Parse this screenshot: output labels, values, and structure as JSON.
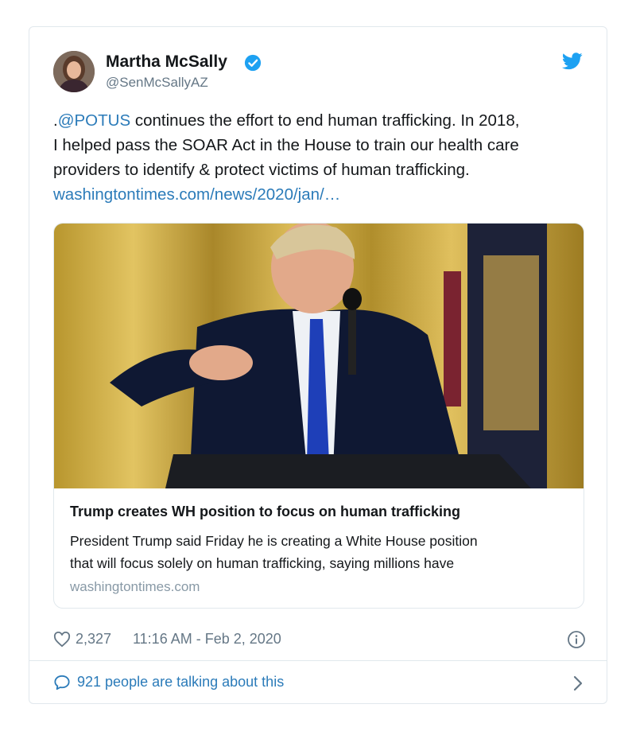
{
  "tweet": {
    "author": {
      "name": "Martha McSally",
      "handle": "@SenMcSallyAZ",
      "verified_icon": "verified-badge-icon",
      "avatar": "avatar-photo"
    },
    "brand_icon": "twitter-bird-icon",
    "text_lines": [
      {
        "prefix": ".",
        "mention": "@POTUS",
        "rest": " continues the effort to end human trafficking. In 2018,"
      },
      "I helped pass the SOAR Act in the House to train our health care",
      "providers to identify & protect victims of human trafficking."
    ],
    "link_text": "washingtontimes.com/news/2020/jan/…",
    "card": {
      "image": "photo-speaker-at-podium",
      "title": "Trump creates WH position to focus on human trafficking",
      "description_lines": [
        "President Trump said Friday he is creating a White House position",
        "that will focus solely on human trafficking, saying millions have"
      ],
      "domain": "washingtontimes.com"
    },
    "likes": "2,327",
    "timestamp": "11:16 AM - Feb 2, 2020",
    "talking": "921 people are talking about this"
  },
  "colors": {
    "link": "#2b7bb9",
    "verified": "#1da1f2",
    "secondary_text": "#657786",
    "border": "#e1e8ed"
  }
}
